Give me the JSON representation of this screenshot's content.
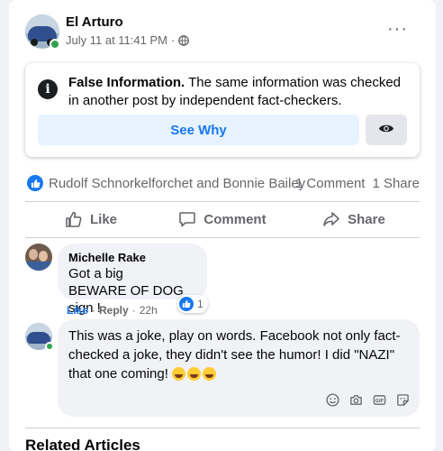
{
  "post": {
    "author": "El Arturo",
    "timestamp": "July 11 at 11:41 PM",
    "separator": "·",
    "privacy_icon": "globe-icon",
    "more_label": "···"
  },
  "false_info": {
    "heading": "False Information.",
    "body": " The same information was checked in another post by independent fact-checkers.",
    "see_why_label": "See Why",
    "icon": "info-icon"
  },
  "reactions": {
    "names": "Rudolf Schnorkelforchet and Bonnie Bailey",
    "comments": "1 Comment",
    "shares": "1 Share"
  },
  "actions": {
    "like": "Like",
    "comment": "Comment",
    "share": "Share"
  },
  "comments": [
    {
      "name": "Michelle Rake",
      "line1": "Got a big",
      "line2": "BEWARE OF DOG sign !",
      "reaction_count": "1",
      "like_label": "Like",
      "dot": "·",
      "reply_label": "Reply",
      "age": "22h"
    }
  ],
  "composer": {
    "text": "This was a joke, play on words. Facebook not only fact-checked a joke, they didn't see the humor! I did \"NAZI\" that one coming!",
    "emojis": [
      "laughing-emoji",
      "rolling-laughing-emoji",
      "laughing-emoji"
    ],
    "tools": [
      "emoji-icon",
      "camera-icon",
      "gif-icon",
      "sticker-icon"
    ]
  },
  "related": {
    "title": "Related Articles"
  },
  "colors": {
    "accent": "#1877f2",
    "secondary_text": "#65676b",
    "online": "#31a24c",
    "see_why_bg": "#e7f3ff"
  }
}
